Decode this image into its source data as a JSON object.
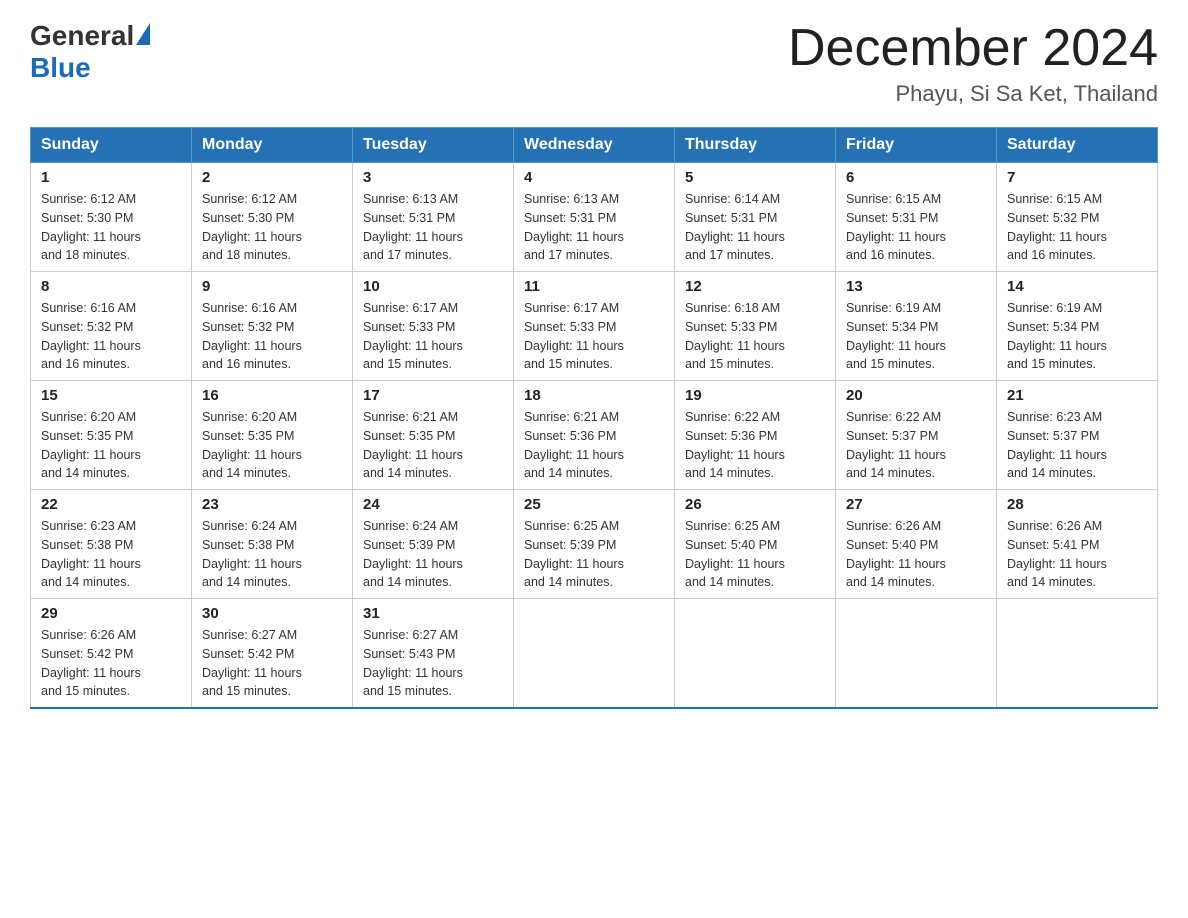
{
  "logo": {
    "general": "General",
    "blue": "Blue"
  },
  "header": {
    "month_year": "December 2024",
    "location": "Phayu, Si Sa Ket, Thailand"
  },
  "weekdays": [
    "Sunday",
    "Monday",
    "Tuesday",
    "Wednesday",
    "Thursday",
    "Friday",
    "Saturday"
  ],
  "weeks": [
    [
      {
        "day": "1",
        "sunrise": "6:12 AM",
        "sunset": "5:30 PM",
        "daylight": "11 hours and 18 minutes."
      },
      {
        "day": "2",
        "sunrise": "6:12 AM",
        "sunset": "5:30 PM",
        "daylight": "11 hours and 18 minutes."
      },
      {
        "day": "3",
        "sunrise": "6:13 AM",
        "sunset": "5:31 PM",
        "daylight": "11 hours and 17 minutes."
      },
      {
        "day": "4",
        "sunrise": "6:13 AM",
        "sunset": "5:31 PM",
        "daylight": "11 hours and 17 minutes."
      },
      {
        "day": "5",
        "sunrise": "6:14 AM",
        "sunset": "5:31 PM",
        "daylight": "11 hours and 17 minutes."
      },
      {
        "day": "6",
        "sunrise": "6:15 AM",
        "sunset": "5:31 PM",
        "daylight": "11 hours and 16 minutes."
      },
      {
        "day": "7",
        "sunrise": "6:15 AM",
        "sunset": "5:32 PM",
        "daylight": "11 hours and 16 minutes."
      }
    ],
    [
      {
        "day": "8",
        "sunrise": "6:16 AM",
        "sunset": "5:32 PM",
        "daylight": "11 hours and 16 minutes."
      },
      {
        "day": "9",
        "sunrise": "6:16 AM",
        "sunset": "5:32 PM",
        "daylight": "11 hours and 16 minutes."
      },
      {
        "day": "10",
        "sunrise": "6:17 AM",
        "sunset": "5:33 PM",
        "daylight": "11 hours and 15 minutes."
      },
      {
        "day": "11",
        "sunrise": "6:17 AM",
        "sunset": "5:33 PM",
        "daylight": "11 hours and 15 minutes."
      },
      {
        "day": "12",
        "sunrise": "6:18 AM",
        "sunset": "5:33 PM",
        "daylight": "11 hours and 15 minutes."
      },
      {
        "day": "13",
        "sunrise": "6:19 AM",
        "sunset": "5:34 PM",
        "daylight": "11 hours and 15 minutes."
      },
      {
        "day": "14",
        "sunrise": "6:19 AM",
        "sunset": "5:34 PM",
        "daylight": "11 hours and 15 minutes."
      }
    ],
    [
      {
        "day": "15",
        "sunrise": "6:20 AM",
        "sunset": "5:35 PM",
        "daylight": "11 hours and 14 minutes."
      },
      {
        "day": "16",
        "sunrise": "6:20 AM",
        "sunset": "5:35 PM",
        "daylight": "11 hours and 14 minutes."
      },
      {
        "day": "17",
        "sunrise": "6:21 AM",
        "sunset": "5:35 PM",
        "daylight": "11 hours and 14 minutes."
      },
      {
        "day": "18",
        "sunrise": "6:21 AM",
        "sunset": "5:36 PM",
        "daylight": "11 hours and 14 minutes."
      },
      {
        "day": "19",
        "sunrise": "6:22 AM",
        "sunset": "5:36 PM",
        "daylight": "11 hours and 14 minutes."
      },
      {
        "day": "20",
        "sunrise": "6:22 AM",
        "sunset": "5:37 PM",
        "daylight": "11 hours and 14 minutes."
      },
      {
        "day": "21",
        "sunrise": "6:23 AM",
        "sunset": "5:37 PM",
        "daylight": "11 hours and 14 minutes."
      }
    ],
    [
      {
        "day": "22",
        "sunrise": "6:23 AM",
        "sunset": "5:38 PM",
        "daylight": "11 hours and 14 minutes."
      },
      {
        "day": "23",
        "sunrise": "6:24 AM",
        "sunset": "5:38 PM",
        "daylight": "11 hours and 14 minutes."
      },
      {
        "day": "24",
        "sunrise": "6:24 AM",
        "sunset": "5:39 PM",
        "daylight": "11 hours and 14 minutes."
      },
      {
        "day": "25",
        "sunrise": "6:25 AM",
        "sunset": "5:39 PM",
        "daylight": "11 hours and 14 minutes."
      },
      {
        "day": "26",
        "sunrise": "6:25 AM",
        "sunset": "5:40 PM",
        "daylight": "11 hours and 14 minutes."
      },
      {
        "day": "27",
        "sunrise": "6:26 AM",
        "sunset": "5:40 PM",
        "daylight": "11 hours and 14 minutes."
      },
      {
        "day": "28",
        "sunrise": "6:26 AM",
        "sunset": "5:41 PM",
        "daylight": "11 hours and 14 minutes."
      }
    ],
    [
      {
        "day": "29",
        "sunrise": "6:26 AM",
        "sunset": "5:42 PM",
        "daylight": "11 hours and 15 minutes."
      },
      {
        "day": "30",
        "sunrise": "6:27 AM",
        "sunset": "5:42 PM",
        "daylight": "11 hours and 15 minutes."
      },
      {
        "day": "31",
        "sunrise": "6:27 AM",
        "sunset": "5:43 PM",
        "daylight": "11 hours and 15 minutes."
      },
      null,
      null,
      null,
      null
    ]
  ],
  "labels": {
    "sunrise": "Sunrise:",
    "sunset": "Sunset:",
    "daylight": "Daylight:"
  }
}
